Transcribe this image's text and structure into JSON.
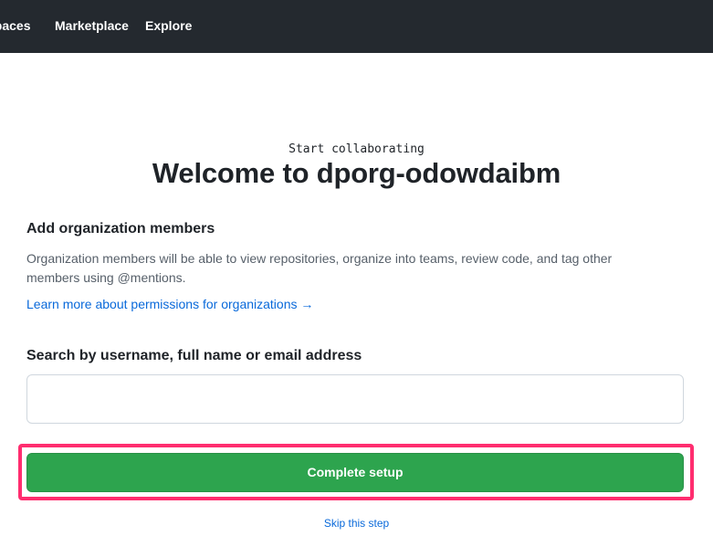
{
  "header": {
    "nav": [
      {
        "label": "spaces"
      },
      {
        "label": "Marketplace"
      },
      {
        "label": "Explore"
      }
    ]
  },
  "main": {
    "eyebrow": "Start collaborating",
    "title": "Welcome to dporg-odowdaibm",
    "section_heading": "Add organization members",
    "section_description": "Organization members will be able to view repositories, organize into teams, review code, and tag other members using @mentions.",
    "permissions_link": "Learn more about permissions for organizations →",
    "search_label": "Search by username, full name or email address",
    "search_value": "",
    "complete_button": "Complete setup",
    "skip_link": "Skip this step"
  },
  "colors": {
    "header_bg": "#24292f",
    "primary_green": "#2da44e",
    "link_blue": "#0969da",
    "highlight": "#ff2d6f"
  }
}
